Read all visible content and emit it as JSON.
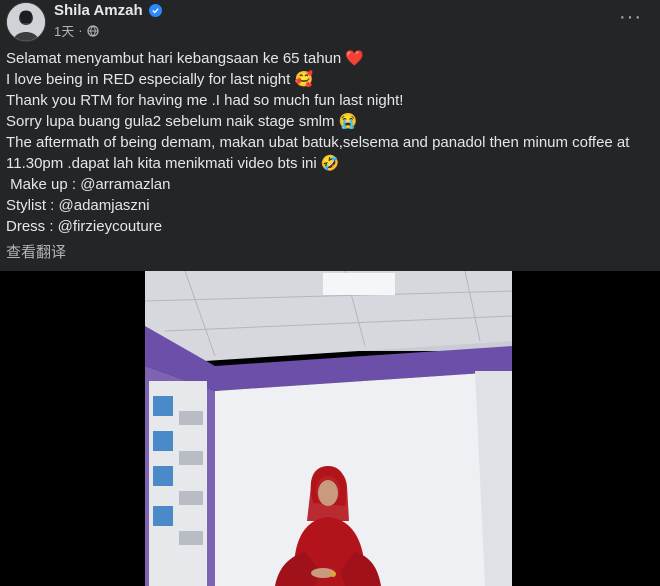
{
  "author": {
    "name": "Shila Amzah",
    "time": "1天",
    "verified_icon": "verified-badge-icon",
    "privacy_icon": "globe-icon"
  },
  "post": {
    "lines": [
      "Selamat menyambut hari kebangsaan ke 65 tahun ❤️",
      "I love being in RED especially for last night 🥰",
      "Thank you RTM for having me .I had so much fun last night!",
      "Sorry lupa buang gula2 sebelum naik stage smlm 😭",
      "The aftermath of being demam, makan ubat batuk,selsema and panadol then minum coffee at",
      "11.30pm .dapat lah kita menikmati video bts ini 🤣",
      " Make up : @arramazlan",
      "Stylist : @adamjaszni",
      "Dress : @firzieycouture"
    ],
    "translate_label": "查看翻译"
  },
  "menu": {
    "more_label": "···"
  },
  "colors": {
    "background": "#242526",
    "text_primary": "#e4e6eb",
    "text_secondary": "#b0b3b8",
    "verified_blue": "#2d88ff",
    "dress_red": "#b3141c"
  }
}
